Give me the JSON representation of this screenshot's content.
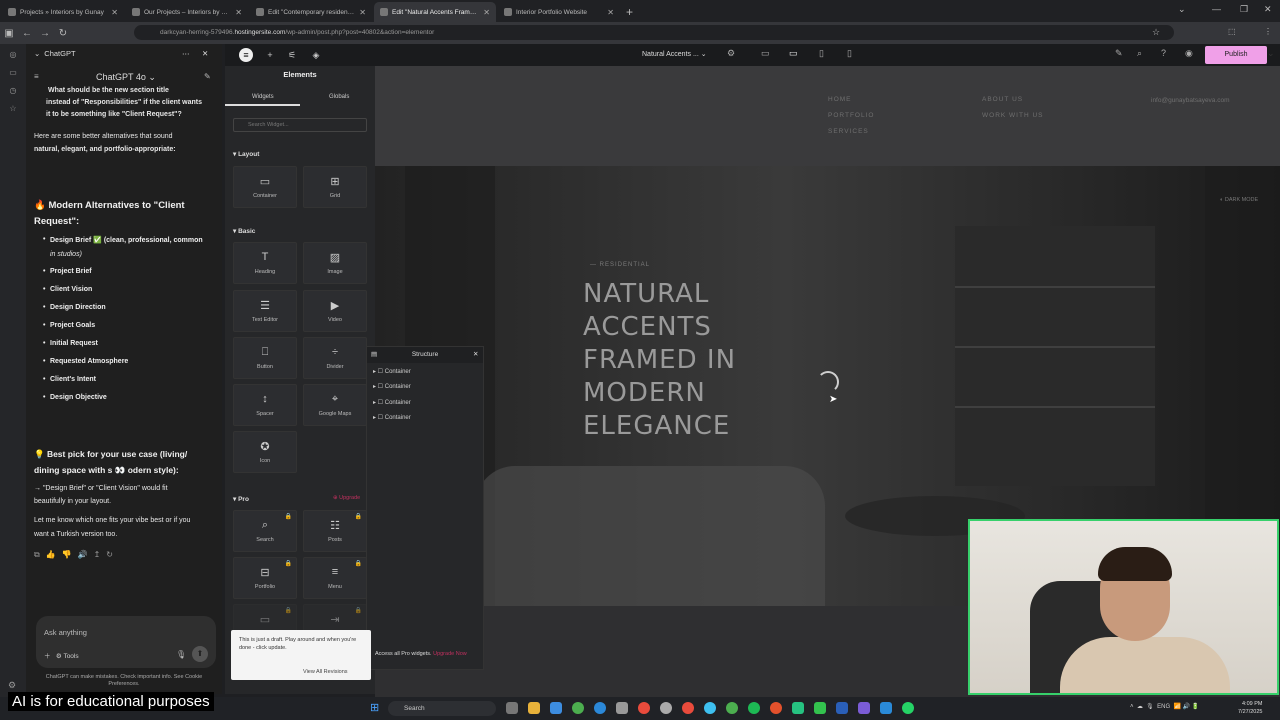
{
  "browser": {
    "tabs": [
      {
        "title": "Projects » Interiors by Gunay"
      },
      {
        "title": "Our Projects – Interiors by Gunay"
      },
      {
        "title": "Edit \"Contemporary residence\""
      },
      {
        "title": "Edit \"Natural Accents Framed in\""
      },
      {
        "title": "Interior Portfolio Website"
      }
    ],
    "url_prefix": "darkcyan-herring-579496.",
    "url_host": "hostingersite.com",
    "url_path": "/wp-admin/post.php?post=40802&action=elementor"
  },
  "chatgpt": {
    "header_title": "ChatGPT",
    "model": "ChatGPT 4o",
    "question_line1": "What should be the new section title",
    "question_line2": "instead of \"Responsibilities\" if the client wants",
    "question_line3": "it to be something like \"Client Request\"?",
    "intro_line1": "Here are some better alternatives that sound",
    "intro_line2": "natural, elegant, and portfolio-appropriate:",
    "heading1_line1": "🔥 Modern Alternatives to \"Client",
    "heading1_line2": "Request\":",
    "items": [
      "Design Brief ✅ (clean, professional, common",
      "in studios)",
      "Project Brief",
      "Client Vision",
      "Design Direction",
      "Project Goals",
      "Initial Request",
      "Requested Atmosphere",
      "Client's Intent",
      "Design Objective"
    ],
    "heading2_line1": "💡 Best pick for your use case (living/",
    "heading2_line2": "dining space with s 👀 odern style):",
    "pick_line1": "→ \"Design Brief\" or \"Client Vision\" would fit",
    "pick_line2": "beautifully in your layout.",
    "closing_line1": "Let me know which one fits your vibe best or if you",
    "closing_line2": "want a Turkish version too.",
    "ask_placeholder": "Ask anything",
    "tools_label": "Tools",
    "disclaimer": "ChatGPT can make mistakes. Check important info. See Cookie Preferences."
  },
  "elementor": {
    "panel_title": "Elements",
    "tab_widgets": "Widgets",
    "tab_globals": "Globals",
    "search_placeholder": "Search Widget...",
    "section_layout": "Layout",
    "section_basic": "Basic",
    "section_pro": "Pro",
    "upgrade_label": "Upgrade",
    "widgets_layout": [
      "Container",
      "Grid"
    ],
    "widgets_basic": [
      "Heading",
      "Image",
      "Text Editor",
      "Video",
      "Button",
      "Divider",
      "Spacer",
      "Google Maps",
      "Icon"
    ],
    "widgets_pro": [
      "Search",
      "Posts",
      "Portfolio",
      "Menu"
    ],
    "page_name": "Natural Accents ...",
    "publish_label": "Publish",
    "structure_title": "Structure",
    "structure_items": [
      "Container",
      "Container",
      "Container",
      "Container"
    ],
    "pro_access": "Access all Pro widgets.",
    "pro_access_link": "Upgrade Now",
    "draft_text": "This is just a draft. Play around and when you're done - click update.",
    "view_revisions": "View All Revisions"
  },
  "site": {
    "nav_left": [
      "HOME",
      "PORTFOLIO",
      "SERVICES"
    ],
    "nav_right": [
      "ABOUT US",
      "WORK WITH US"
    ],
    "email": "info@gunaybatsayeva.com",
    "dark_mode": "DARK MODE",
    "eyebrow": "— RESIDENTIAL",
    "hero_title": "NATURAL ACCENTS FRAMED IN MODERN ELEGANCE"
  },
  "taskbar": {
    "search": "Search",
    "lang": "ENG",
    "time": "4:09 PM",
    "date": "7/27/2025"
  },
  "caption": "AI is for educational purposes"
}
